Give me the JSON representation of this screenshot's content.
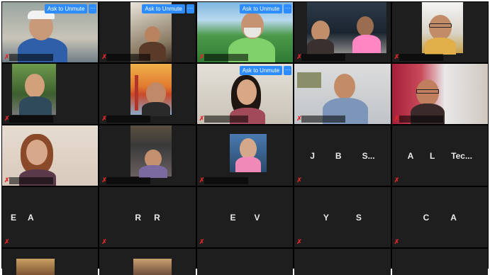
{
  "meeting": {
    "ask_to_unmute": "Ask to Unmute",
    "more_icon": "···",
    "muted_icon": "muted-mic-icon"
  },
  "tiles": [
    {
      "id": "t1",
      "type": "video",
      "ask_unmute": true
    },
    {
      "id": "t2",
      "type": "video",
      "ask_unmute": true
    },
    {
      "id": "t3",
      "type": "video",
      "ask_unmute": true
    },
    {
      "id": "t4",
      "type": "video"
    },
    {
      "id": "t5",
      "type": "video"
    },
    {
      "id": "t6",
      "type": "video"
    },
    {
      "id": "t7",
      "type": "video"
    },
    {
      "id": "t8",
      "type": "video",
      "ask_unmute": true
    },
    {
      "id": "t9",
      "type": "video"
    },
    {
      "id": "t10",
      "type": "video"
    },
    {
      "id": "t11",
      "type": "video"
    },
    {
      "id": "t12",
      "type": "video"
    },
    {
      "id": "t13",
      "type": "video"
    },
    {
      "id": "t14",
      "type": "name",
      "initials": [
        "J",
        "B",
        "S..."
      ]
    },
    {
      "id": "t15",
      "type": "name",
      "initials": [
        "A",
        "L",
        "Tec..."
      ]
    },
    {
      "id": "t16",
      "type": "name",
      "initials": [
        "E",
        "A"
      ]
    },
    {
      "id": "t17",
      "type": "name",
      "initials": [
        "R",
        "R"
      ]
    },
    {
      "id": "t18",
      "type": "name",
      "initials": [
        "E",
        "V"
      ]
    },
    {
      "id": "t19",
      "type": "name",
      "initials": [
        "Y",
        "S"
      ]
    },
    {
      "id": "t20",
      "type": "name",
      "initials": [
        "C",
        "A"
      ]
    }
  ]
}
